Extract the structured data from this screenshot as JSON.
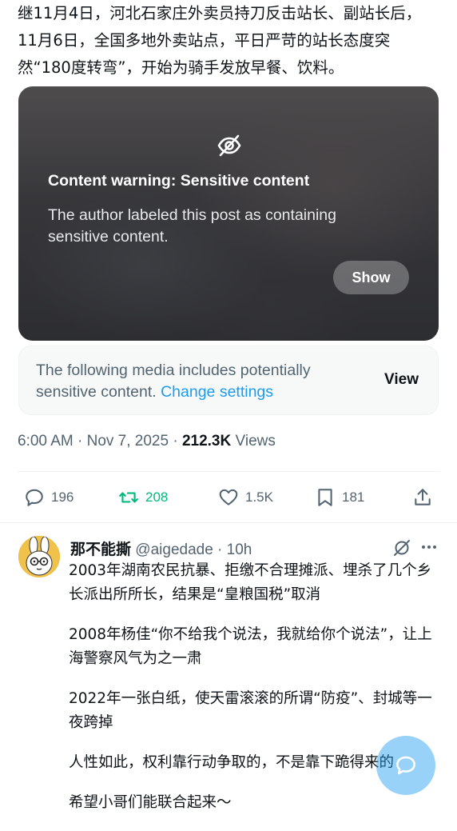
{
  "tweet": {
    "text": "继11月4日，河北石家庄外卖员持刀反击站长、副站长后，11月6日，全国多地外卖站点，平日严苛的站长态度突然“180度转弯”，开始为骑手发放早餐、饮料。"
  },
  "media": {
    "warning_title": "Content warning: Sensitive content",
    "warning_desc": "The author labeled this post as containing sensitive content.",
    "show_label": "Show",
    "icon": "eye-slash-icon"
  },
  "notice": {
    "text": "The following media includes potentially sensitive content.",
    "link": "Change settings",
    "view_label": "View"
  },
  "meta": {
    "time": "6:00 AM · Nov 7, 2025 · ",
    "views_count": "212.3K",
    "views_label": " Views"
  },
  "actions": {
    "replies": "196",
    "retweets": "208",
    "likes": "1.5K",
    "bookmarks": "181"
  },
  "reply": {
    "name": "那不能撕",
    "handle": "@aigedade · 10h",
    "paragraphs": [
      "2003年湖南农民抗暴、拒缴不合理摊派、埋杀了几个乡长派出所所长，结果是“皇粮国税”取消",
      "2008年杨佳“你不给我个说法，我就给你个说法”，让上海警察风气为之一肃",
      "2022年一张白纸，使天雷滚滚的所谓“防疫”、封城等一夜跨掉",
      "人性如此，权利靠行动争取的，不是靠下跪得来的",
      "希望小哥们能联合起来～"
    ]
  },
  "colors": {
    "accent": "#1d9bf0",
    "retweet": "#00ba7c",
    "secondary_text": "#536471"
  }
}
